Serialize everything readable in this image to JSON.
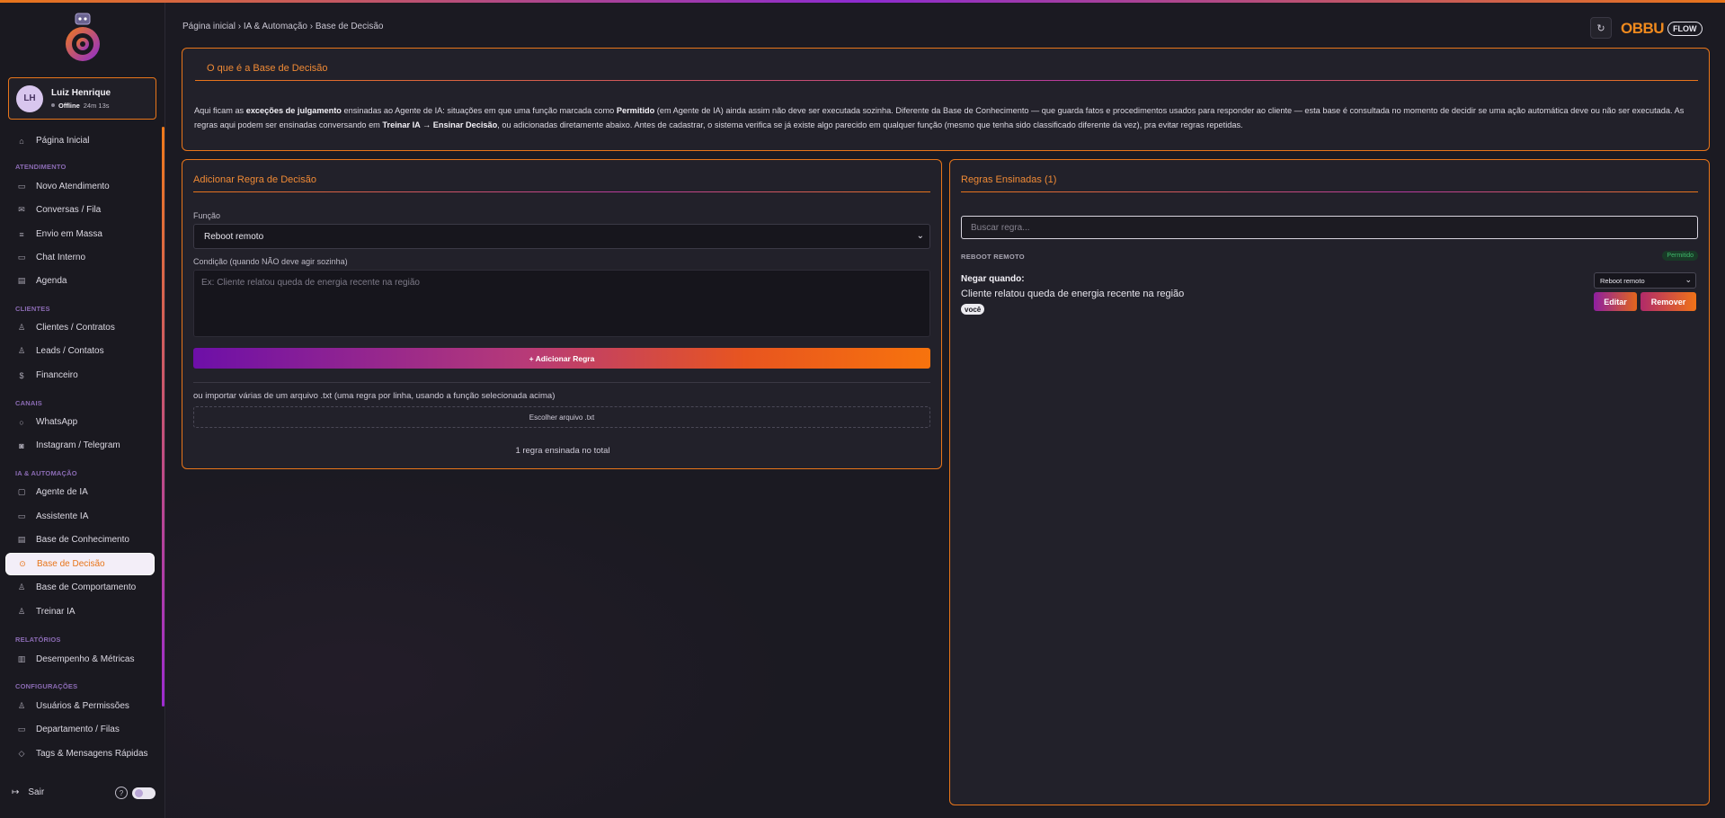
{
  "sidebar": {
    "user": {
      "initials": "LH",
      "name": "Luiz Henrique",
      "status": "Offline",
      "duration": "24m 13s"
    },
    "nav": {
      "home": "Página Inicial",
      "sections": {
        "atendimento": "ATENDIMENTO",
        "clientes": "CLIENTES",
        "canais": "CANAIS",
        "ia": "IA & AUTOMAÇÃO",
        "relatorios": "RELATÓRIOS",
        "config": "CONFIGURAÇÕES"
      },
      "items": {
        "novo_atendimento": "Novo Atendimento",
        "conversas": "Conversas / Fila",
        "envio_massa": "Envio em Massa",
        "chat_interno": "Chat Interno",
        "agenda": "Agenda",
        "clientes_contratos": "Clientes / Contratos",
        "leads": "Leads / Contatos",
        "financeiro": "Financeiro",
        "whatsapp": "WhatsApp",
        "instagram": "Instagram / Telegram",
        "agente_ia": "Agente de IA",
        "assistente_ia": "Assistente IA",
        "base_conhecimento": "Base de Conhecimento",
        "base_decisao": "Base de Decisão",
        "base_comportamento": "Base de Comportamento",
        "treinar_ia": "Treinar IA",
        "desempenho": "Desempenho & Métricas",
        "usuarios": "Usuários & Permissões",
        "departamento": "Departamento / Filas",
        "tags": "Tags & Mensagens Rápidas"
      }
    },
    "footer": {
      "logout": "Sair",
      "help": "?"
    }
  },
  "header": {
    "breadcrumb": "Página inicial › IA & Automação › Base de Decisão",
    "brand": {
      "logo": "OBBU",
      "badge": "FLOW"
    }
  },
  "info": {
    "title": "O que é a Base de Decisão",
    "p1": "Aqui ficam as ",
    "p1_bold": "exceções de julgamento",
    "p2": " ensinadas ao Agente de IA: situações em que uma função marcada como ",
    "p2_bold": "Permitido",
    "p3": " (em Agente de IA) ainda assim não deve ser executada sozinha. Diferente da Base de Conhecimento — que guarda fatos e procedimentos usados para responder ao cliente — esta base é consultada no momento de decidir se uma ação automática deve ou não ser executada. As regras aqui podem ser ensinadas conversando em ",
    "p3_bold": "Treinar IA → Ensinar Decisão",
    "p4": ", ou adicionadas diretamente abaixo. Antes de cadastrar, o sistema verifica se já existe algo parecido em qualquer função (mesmo que tenha sido classificado diferente da vez), pra evitar regras repetidas."
  },
  "add_rule": {
    "title": "Adicionar Regra de Decisão",
    "function_label": "Função",
    "function_value": "Reboot remoto",
    "condition_label": "Condição (quando NÃO deve agir sozinha)",
    "condition_placeholder": "Ex: Cliente relatou queda de energia recente na região",
    "add_button": "+ Adicionar Regra",
    "import_text": "ou importar várias de um arquivo .txt (uma regra por linha, usando a função selecionada acima)",
    "file_button": "Escolher arquivo .txt",
    "total": "1 regra ensinada no total"
  },
  "rules": {
    "title": "Regras Ensinadas (1)",
    "search_placeholder": "Buscar regra...",
    "group": "REBOOT REMOTO",
    "status": "Permitido",
    "items": [
      {
        "when_label": "Negar quando:",
        "condition": "Cliente relatou queda de energia recente na região",
        "author": "você",
        "function": "Reboot remoto",
        "edit": "Editar",
        "remove": "Remover"
      }
    ]
  },
  "colors": {
    "accent": "#e8751a",
    "purple": "#8d2bd1",
    "success": "#3fb86a",
    "background": "#1b1a22"
  }
}
